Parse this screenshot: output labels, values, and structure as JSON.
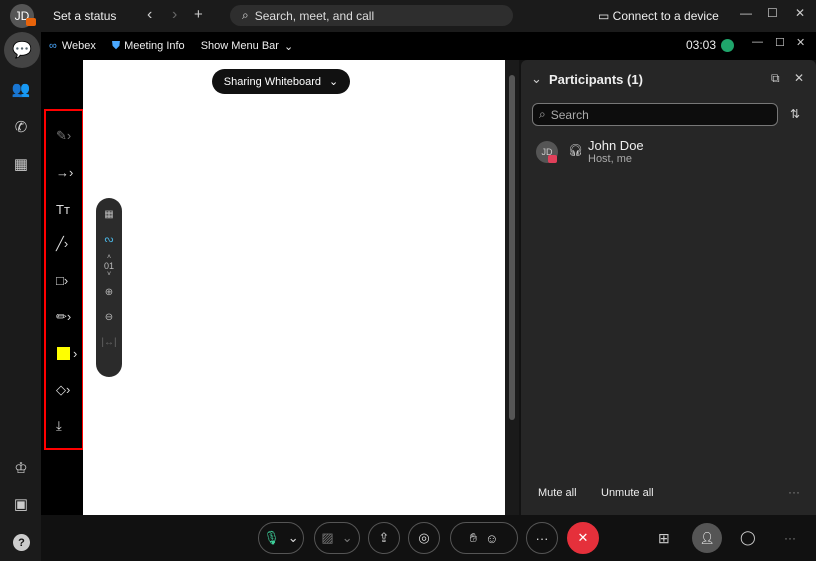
{
  "topbar": {
    "avatar_initials": "JD",
    "status": "Set a status",
    "search_placeholder": "Search, meet, and call",
    "connect": "Connect to a device"
  },
  "meeting": {
    "brand": "Webex",
    "info": "Meeting Info",
    "menu_bar": "Show Menu Bar",
    "timer": "03:03"
  },
  "whiteboard": {
    "share_label": "Sharing Whiteboard",
    "page": "01"
  },
  "colors": {
    "selected_color": "#ffff00",
    "end_call": "#e5303b",
    "connect_green": "#1fa56b"
  },
  "participants": {
    "title": "Participants (1)",
    "search_placeholder": "Search",
    "items": [
      {
        "initials": "JD",
        "name": "John Doe",
        "role": "Host, me"
      }
    ],
    "mute_all": "Mute all",
    "unmute_all": "Unmute all"
  }
}
